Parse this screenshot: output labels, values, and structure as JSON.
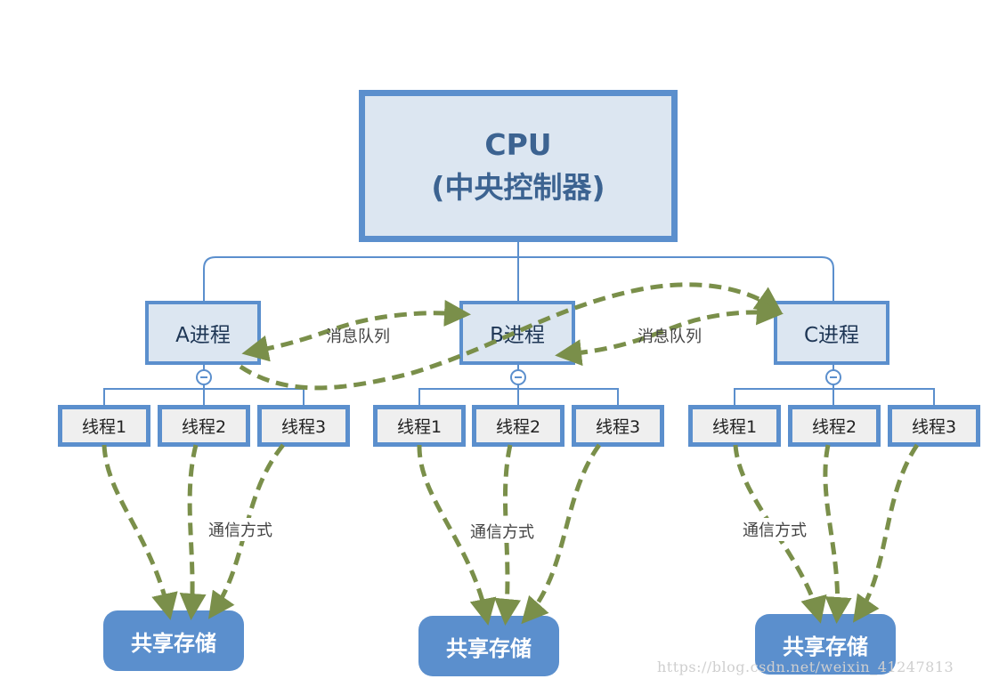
{
  "cpu": {
    "line1": "CPU",
    "line2": "(中央控制器)"
  },
  "processes": [
    {
      "label": "A进程",
      "threads": [
        "线程1",
        "线程2",
        "线程3"
      ],
      "storage": "共享存储",
      "comm_label": "通信方式"
    },
    {
      "label": "B进程",
      "threads": [
        "线程1",
        "线程2",
        "线程3"
      ],
      "storage": "共享存储",
      "comm_label": "通信方式"
    },
    {
      "label": "C进程",
      "threads": [
        "线程1",
        "线程2",
        "线程3"
      ],
      "storage": "共享存储",
      "comm_label": "通信方式"
    }
  ],
  "message_queue_labels": [
    "消息队列",
    "消息队列"
  ],
  "colors": {
    "box_border": "#5b8fcd",
    "box_fill": "#dce6f1",
    "thread_fill": "#efefef",
    "arrow": "#7a8f4a",
    "connector": "#5b8fcd",
    "cpu_text": "#3c6391"
  },
  "watermark": "https://blog.csdn.net/weixin_41247813"
}
